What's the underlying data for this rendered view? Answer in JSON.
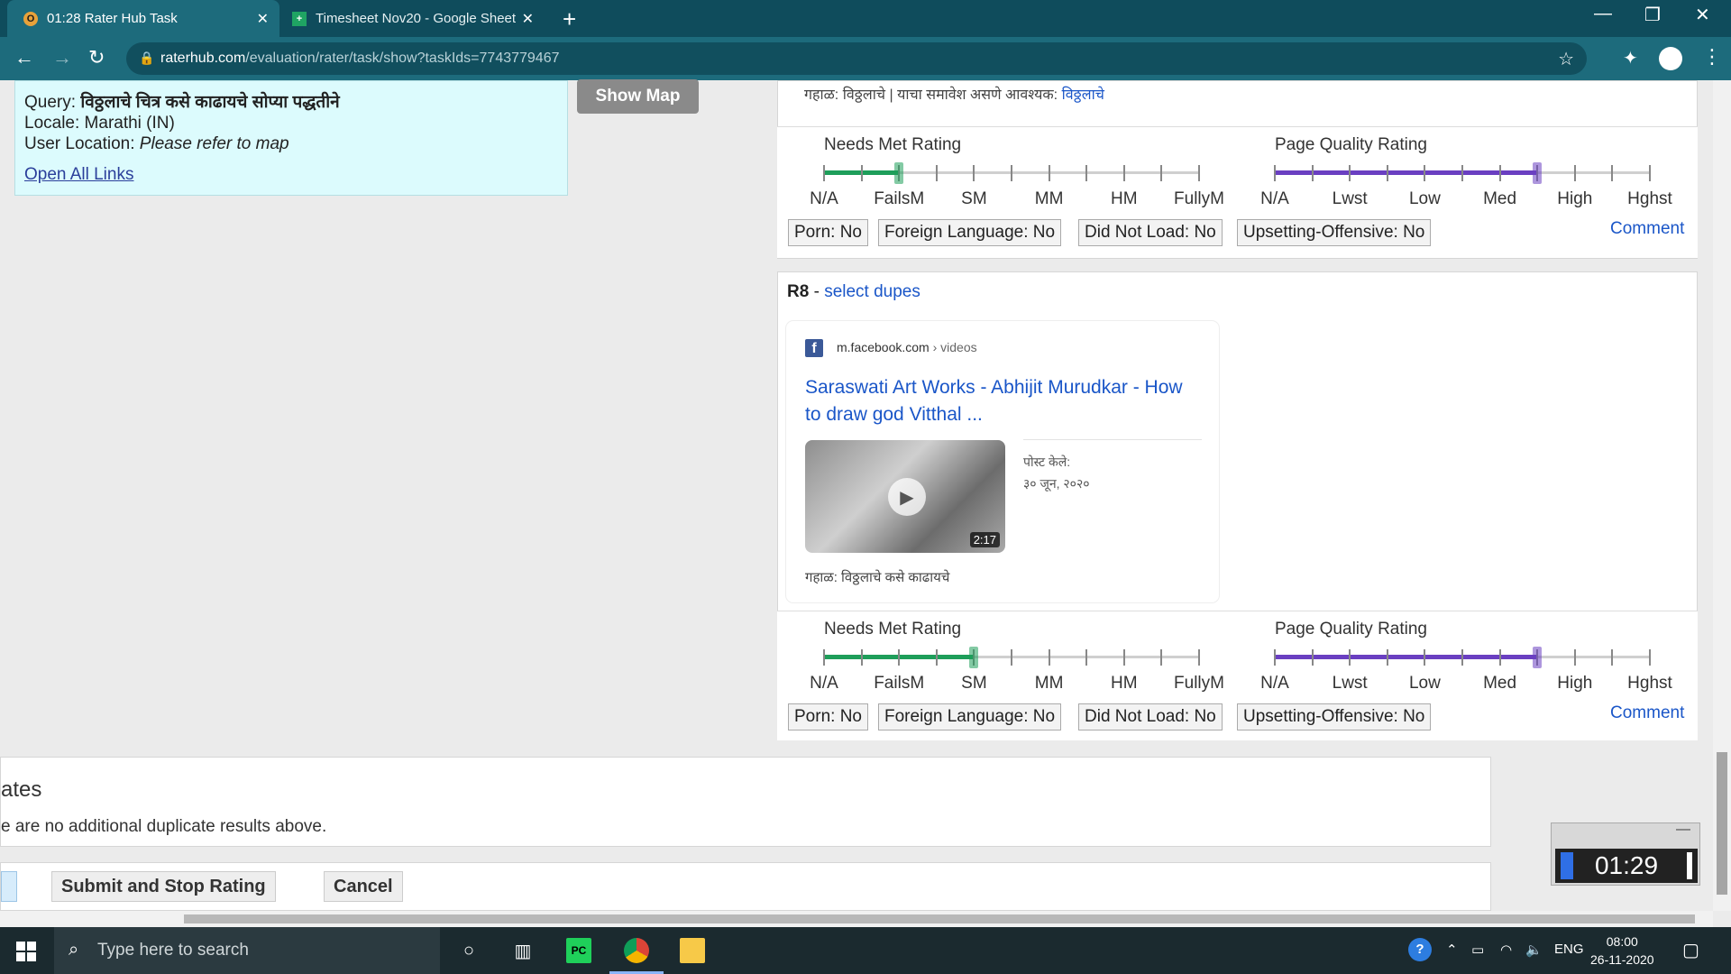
{
  "browser": {
    "tabs": [
      {
        "label": "01:28 Rater Hub Task",
        "favicon": "O"
      },
      {
        "label": "Timesheet Nov20 - Google Sheet",
        "favicon": "+"
      }
    ],
    "url_host": "raterhub.com",
    "url_path": "/evaluation/rater/task/show?taskIds=7743779467"
  },
  "query_box": {
    "query_label": "Query:",
    "query_value": "विठ्ठलाचे चित्र कसे काढायचे सोप्या पद्धतीने",
    "locale": "Locale: Marathi (IN)",
    "user_location_label": "User Location:",
    "user_location_value": "Please refer to map",
    "open_all_links": "Open All Links",
    "show_map": "Show Map"
  },
  "r7": {
    "snippet_prefix": "गहाळ: विठ्ठलाचे | याचा समावेश असणे आवश्यक:",
    "snippet_link": "विठ्ठलाचे",
    "needs_met_title": "Needs Met Rating",
    "needs_met_value": 0.2,
    "page_quality_title": "Page Quality Rating",
    "page_quality_value": 0.7
  },
  "r8": {
    "id": "R8",
    "dash": "-",
    "select_dupes": "select dupes",
    "source_host": "m.facebook.com",
    "source_path": "› videos",
    "title": "Saraswati Art Works - Abhijit Murudkar - How to draw god Vitthal ...",
    "duration": "2:17",
    "posted_label": "पोस्ट केले:",
    "posted_date": "३० जून, २०२०",
    "missing": "गहाळ: विठ्ठलाचे कसे काढायचे",
    "needs_met_title": "Needs Met Rating",
    "needs_met_value": 0.4,
    "page_quality_title": "Page Quality Rating",
    "page_quality_value": 0.7
  },
  "needs_met_labels": [
    "N/A",
    "FailsM",
    "SM",
    "MM",
    "HM",
    "FullyM"
  ],
  "page_quality_labels": [
    "N/A",
    "Lwst",
    "Low",
    "Med",
    "High",
    "Hghst"
  ],
  "flags": [
    "Porn: No",
    "Foreign Language: No",
    "Did Not Load: No",
    "Upsetting-Offensive: No"
  ],
  "comment": "Comment",
  "colors": {
    "needs_met": "#1e9e5a",
    "page_quality": "#6a3fc1"
  },
  "duplicates": {
    "heading": "ates",
    "text": "e are no additional duplicate results above."
  },
  "actions": {
    "submit": "Submit and Stop Rating",
    "cancel": "Cancel"
  },
  "timer": {
    "time": "01:29",
    "minimize": "—"
  },
  "taskbar": {
    "search_placeholder": "Type here to search",
    "lang": "ENG",
    "time": "08:00",
    "date": "26-11-2020"
  }
}
